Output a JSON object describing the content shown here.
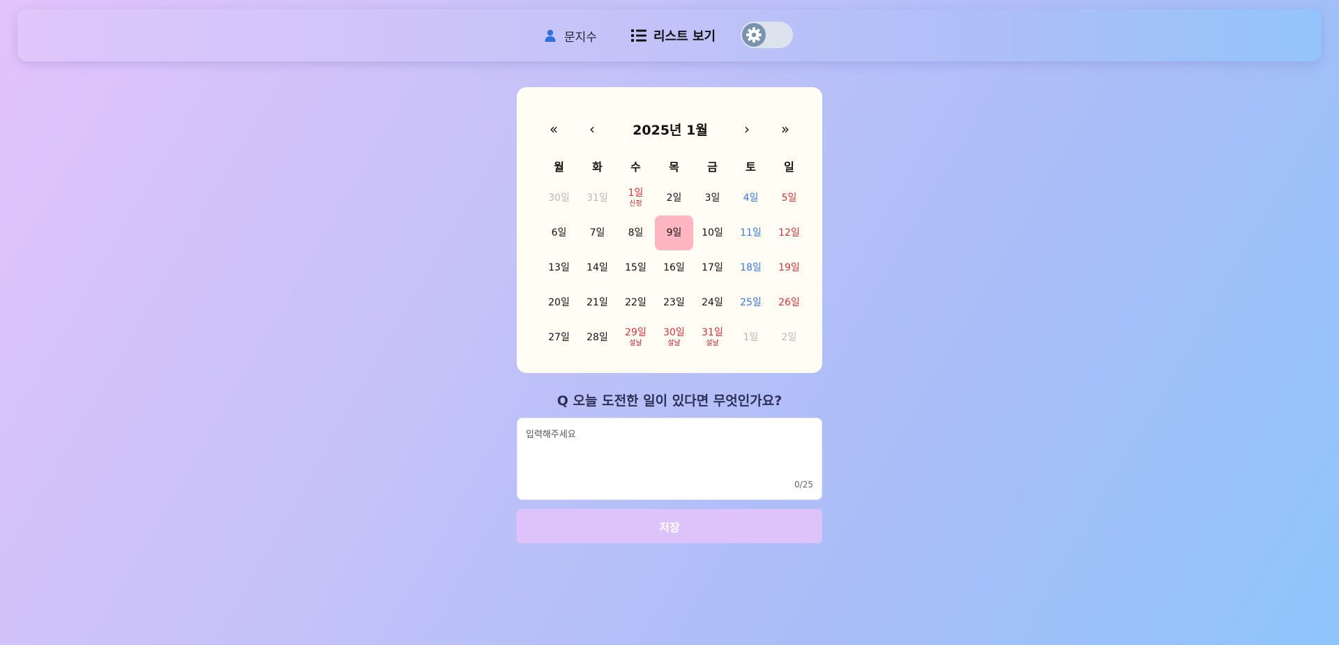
{
  "nav": {
    "user_name": "문지수",
    "list_label": "리스트 보기",
    "user_icon": "user-icon",
    "list_icon": "list-icon",
    "theme_icon": "gear-icon"
  },
  "calendar": {
    "title": "2025년 1월",
    "first": "«",
    "prev": "‹",
    "next": "›",
    "last": "»",
    "weekdays": [
      "월",
      "화",
      "수",
      "목",
      "금",
      "토",
      "일"
    ],
    "days": [
      {
        "label": "30일",
        "type": "muted"
      },
      {
        "label": "31일",
        "type": "muted"
      },
      {
        "label": "1일",
        "type": "red",
        "holiday": "신정"
      },
      {
        "label": "2일",
        "type": "normal"
      },
      {
        "label": "3일",
        "type": "normal"
      },
      {
        "label": "4일",
        "type": "sat"
      },
      {
        "label": "5일",
        "type": "red"
      },
      {
        "label": "6일",
        "type": "normal"
      },
      {
        "label": "7일",
        "type": "normal"
      },
      {
        "label": "8일",
        "type": "normal"
      },
      {
        "label": "9일",
        "type": "normal",
        "selected": true
      },
      {
        "label": "10일",
        "type": "normal"
      },
      {
        "label": "11일",
        "type": "sat"
      },
      {
        "label": "12일",
        "type": "red"
      },
      {
        "label": "13일",
        "type": "normal"
      },
      {
        "label": "14일",
        "type": "normal"
      },
      {
        "label": "15일",
        "type": "normal"
      },
      {
        "label": "16일",
        "type": "normal"
      },
      {
        "label": "17일",
        "type": "normal"
      },
      {
        "label": "18일",
        "type": "sat"
      },
      {
        "label": "19일",
        "type": "red"
      },
      {
        "label": "20일",
        "type": "normal"
      },
      {
        "label": "21일",
        "type": "normal"
      },
      {
        "label": "22일",
        "type": "normal"
      },
      {
        "label": "23일",
        "type": "normal"
      },
      {
        "label": "24일",
        "type": "normal"
      },
      {
        "label": "25일",
        "type": "sat"
      },
      {
        "label": "26일",
        "type": "red"
      },
      {
        "label": "27일",
        "type": "normal"
      },
      {
        "label": "28일",
        "type": "normal"
      },
      {
        "label": "29일",
        "type": "red",
        "holiday": "설날"
      },
      {
        "label": "30일",
        "type": "red",
        "holiday": "설날"
      },
      {
        "label": "31일",
        "type": "red",
        "holiday": "설날"
      },
      {
        "label": "1일",
        "type": "muted"
      },
      {
        "label": "2일",
        "type": "muted"
      }
    ]
  },
  "question": "Q 오늘 도전한 일이 있다면 무엇인가요?",
  "answer": {
    "placeholder": "입력해주세요",
    "value": "",
    "counter": "0/25"
  },
  "save_label": "저장",
  "colors": {
    "selected_day": "#ffb6c1",
    "saturday": "#3a79d9",
    "holiday": "#d0343a",
    "save_button": "#dec3fb"
  }
}
